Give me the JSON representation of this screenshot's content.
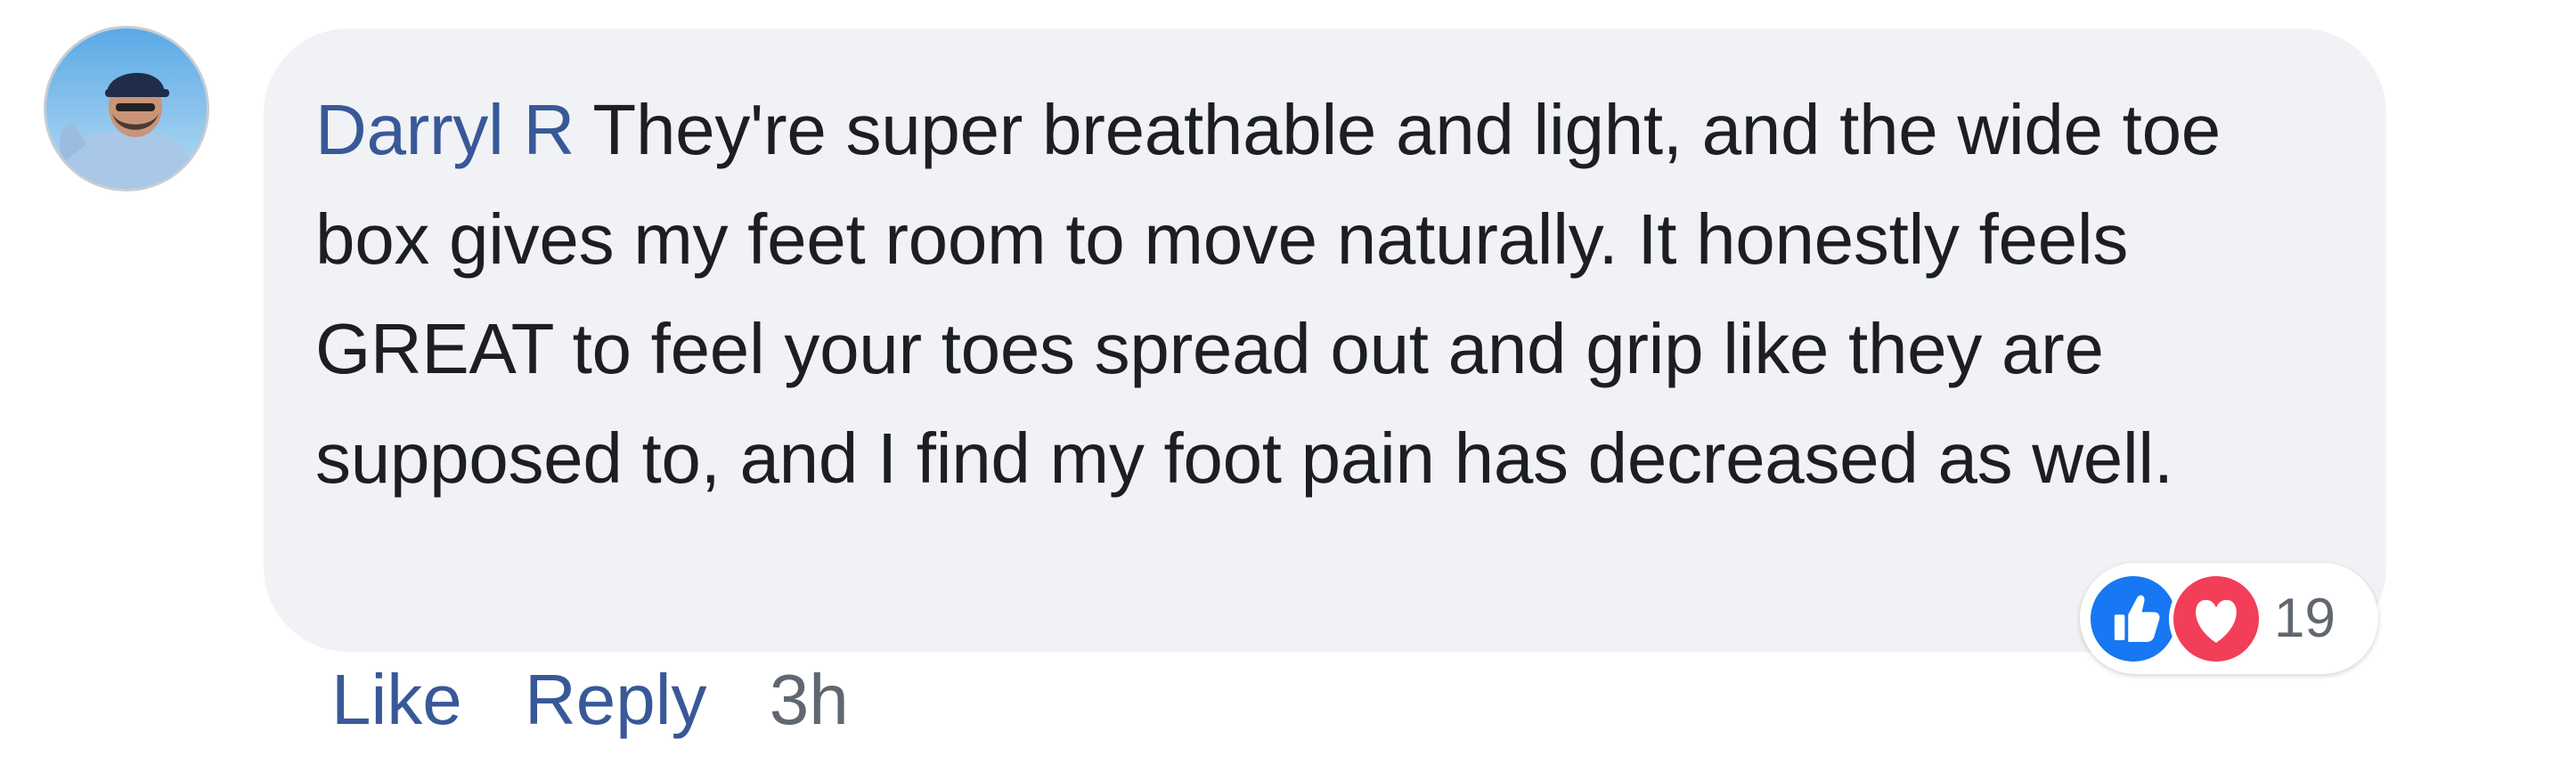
{
  "comment": {
    "author": "Darryl R",
    "text": "They're super breathable and light, and the wide toe box gives my feet room to move naturally. It honestly feels GREAT to feel your toes spread out and grip like they are supposed to, and I find my foot pain has decreased as well.",
    "reactions": {
      "types": [
        "like-icon",
        "love-icon"
      ],
      "count": "19"
    },
    "actions": {
      "like_label": "Like",
      "reply_label": "Reply",
      "timestamp": "3h"
    }
  },
  "colors": {
    "author_link": "#385898",
    "bubble_bg": "#f0f2f5",
    "like_blue": "#1877f2",
    "love_red": "#f33e58",
    "meta_gray": "#606770"
  }
}
